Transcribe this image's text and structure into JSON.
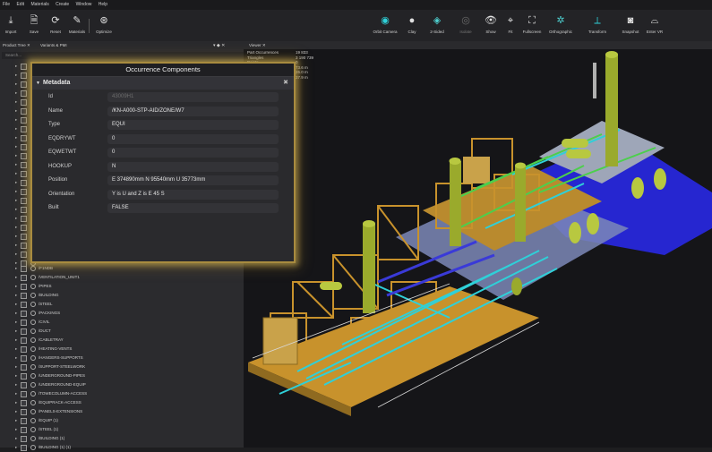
{
  "menubar": {
    "items": [
      "File",
      "Edit",
      "Materials",
      "Create",
      "Window",
      "Help"
    ]
  },
  "toolbar": {
    "left": [
      {
        "icon": "import-icon",
        "label": "Import"
      },
      {
        "icon": "save-icon",
        "label": "Save"
      },
      {
        "icon": "reset-icon",
        "label": "Reset"
      },
      {
        "icon": "materials-icon",
        "label": "Materials"
      },
      {
        "icon": "optimize-icon",
        "label": "Optimize"
      }
    ],
    "right": [
      {
        "icon": "orbit-camera-icon",
        "label": "Orbit Camera"
      },
      {
        "icon": "clay-icon",
        "label": "Clay"
      },
      {
        "icon": "two-sided-icon",
        "label": "2-Sided"
      },
      {
        "icon": "isolate-icon",
        "label": "Isolate"
      },
      {
        "icon": "show-icon",
        "label": "Show"
      },
      {
        "icon": "fit-icon",
        "label": "Fit"
      },
      {
        "icon": "fullscreen-icon",
        "label": "Fullscreen"
      },
      {
        "icon": "orthographic-icon",
        "label": "Orthographic"
      },
      {
        "icon": "transform-icon",
        "label": "Transform"
      },
      {
        "icon": "snapshot-icon",
        "label": "Snapshot"
      },
      {
        "icon": "enter-vr-icon",
        "label": "Enter VR"
      }
    ]
  },
  "tabs": {
    "product_tree": "Product Tree ✕",
    "variants": "Variants & PMI",
    "viewer": "Viewer ✕"
  },
  "search": {
    "placeholder": "Search..."
  },
  "stats": {
    "labels": [
      "Part Occurrences",
      "Triangles",
      "Points"
    ],
    "values": [
      "19 833",
      "3 190 739",
      "0",
      "",
      "73.6 m",
      "26.0 m",
      "37.9 m"
    ]
  },
  "tree": {
    "visible_items": [
      "/F1NDB",
      "/VENTILATION_UNIT1",
      "/PIPES",
      "/BUILDING",
      "/STEEL",
      "/PACKINGS",
      "/CIVIL",
      "/DUCT",
      "/CABLETRAY",
      "/HEATING-VENTS",
      "/HANGERS-SUPPORTS",
      "/SUPPORT-STEELWORK",
      "/UNDERGROUND-PIPES",
      "/UNDERGROUND-EQUIP",
      "/TOWECOLUMN-ACCESS",
      "/EQUIPRACK-ACCESS",
      "/PANELS-EXTENSIONS",
      "/EQUIP (1)",
      "/STEEL (1)",
      "/BUILDING (1)",
      "/BUILDING (1) (1)"
    ]
  },
  "modal": {
    "title": "Occurrence Components",
    "section": "Metadata",
    "properties": [
      {
        "key": "Id",
        "value": "43009H1"
      },
      {
        "key": "Name",
        "value": "/KN-A000-STP-AID/ZONE/W7"
      },
      {
        "key": "Type",
        "value": "EQUI"
      },
      {
        "key": "EQDRYWT",
        "value": "0"
      },
      {
        "key": "EQWETWT",
        "value": "0"
      },
      {
        "key": "HOOKUP",
        "value": "N"
      },
      {
        "key": "Position",
        "value": "E 374890mm N 95540mm U 35773mm"
      },
      {
        "key": "Orientation",
        "value": "Y is U and Z is E 45 S"
      },
      {
        "key": "Built",
        "value": "FALSE"
      }
    ]
  },
  "colors": {
    "accent": "#2fd0d8",
    "modal_glow": "#c9a84a",
    "structure": "#c8922c",
    "equipment": "#9aaa2c",
    "pipe": "#2fd0d8",
    "pad": "#2a2ad8"
  }
}
